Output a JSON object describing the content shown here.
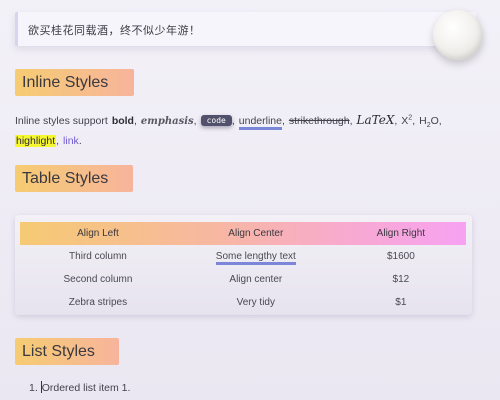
{
  "quote": {
    "text": "欲买桂花同载酒，终不似少年游！"
  },
  "headings": {
    "inline": "Inline Styles",
    "table": "Table Styles",
    "list": "List Styles"
  },
  "inline": {
    "intro": "Inline styles support",
    "bold": "bold",
    "sep1": ",",
    "emphasis": "emphasis",
    "sep2": ",",
    "code": "code",
    "sep3": ",",
    "underline": "underline",
    "sep4": ",",
    "strike": "strikethrough",
    "sep5": ",",
    "latex": "LaTeX",
    "sep6": ",",
    "x_base": "X",
    "x_sup": "2",
    "sep7": ",",
    "h_base": "H",
    "h_sub": "2",
    "o_char": "O",
    "sep8": ",",
    "highlight": "highlight",
    "sep9": ",",
    "link": "link",
    "end": "."
  },
  "table": {
    "headers": [
      "Align Left",
      "Align Center",
      "Align Right"
    ],
    "rows": [
      [
        "Third column",
        "Some lengthy text",
        "$1600"
      ],
      [
        "Second column",
        "Align center",
        "$12"
      ],
      [
        "Zebra stripes",
        "Very tidy",
        "$1"
      ]
    ]
  },
  "list": {
    "items": [
      {
        "marker": "1.",
        "text": "Ordered list item 1."
      }
    ]
  },
  "colors": {
    "heading_gradient_start": "#f6cc72",
    "heading_gradient_end": "#f7b49c",
    "table_header_end": "#f7a2f2",
    "underline": "#7b86d8",
    "highlight": "#f6f631",
    "link": "#6e5ad0",
    "code_bg": "#51516b"
  }
}
